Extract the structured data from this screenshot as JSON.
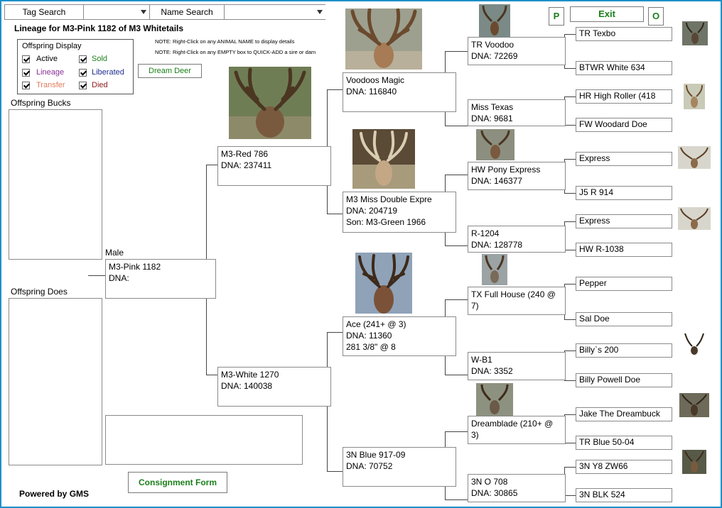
{
  "toolbar": {
    "tag_search_label": "Tag Search",
    "tag_search_value": "",
    "name_search_label": "Name Search",
    "name_search_value": "",
    "p_button": "P",
    "exit_button": "Exit",
    "o_button": "O"
  },
  "header": {
    "title": "Lineage for M3-Pink 1182 of M3 Whitetails",
    "note1": "NOTE: Right-Click on any ANIMAL NAME to display details",
    "note2": "NOTE: Right-Click on any EMPTY box to QUICK-ADD a sire or dam"
  },
  "offspring_display": {
    "title": "Offspring Display",
    "options": [
      {
        "label": "Active",
        "color": "#000000",
        "checked": true
      },
      {
        "label": "Sold",
        "color": "#1a7f1a",
        "checked": true
      },
      {
        "label": "Lineage",
        "color": "#8b2f9a",
        "checked": true
      },
      {
        "label": "Liberated",
        "color": "#1f2f8f",
        "checked": true
      },
      {
        "label": "Transfer",
        "color": "#e07a5a",
        "checked": true
      },
      {
        "label": "Died",
        "color": "#8b1a1a",
        "checked": true
      }
    ]
  },
  "dream_deer_button": "Dream Deer",
  "offspring_bucks_label": "Offspring Bucks",
  "offspring_does_label": "Offspring Does",
  "consignment_button": "Consignment Form",
  "powered_by": "Powered by GMS",
  "pedigree": {
    "subject": {
      "sex_label": "Male",
      "name": "M3-Pink 1182",
      "dna": "DNA:"
    },
    "sire": {
      "name": "M3-Red 786",
      "dna": "DNA: 237411"
    },
    "dam": {
      "name": "M3-White 1270",
      "dna": "DNA: 140038"
    },
    "ss": {
      "name": "Voodoos Magic",
      "dna": "DNA: 116840"
    },
    "sd": {
      "name": "M3 Miss Double Expre",
      "dna": "DNA: 204719",
      "extra": "Son: M3-Green 1966"
    },
    "ds": {
      "name": "Ace (241+ @ 3)",
      "dna": "DNA: 11360",
      "extra": "281 3/8\" @ 8"
    },
    "dd": {
      "name": "3N Blue 917-09",
      "dna": "DNA: 70752"
    },
    "sss": {
      "name": "TR Voodoo",
      "dna": "DNA: 72269"
    },
    "ssd": {
      "name": "Miss Texas",
      "dna": "DNA: 9681"
    },
    "sds": {
      "name": "HW Pony Express",
      "dna": "DNA: 146377"
    },
    "sdd": {
      "name": "R-1204",
      "dna": "DNA: 128778"
    },
    "dss": {
      "name": "TX Full House (240 @",
      "name2": "7)"
    },
    "dsd": {
      "name": "W-B1",
      "dna": "DNA: 3352"
    },
    "dds": {
      "name": "Dreamblade (210+ @",
      "name2": "3)"
    },
    "ddd": {
      "name": "3N O 708",
      "dna": "DNA: 30865"
    },
    "g4": [
      "TR Texbo",
      "BTWR White 634",
      "HR High Roller (418",
      "FW Woodard Doe",
      "Express",
      "J5 R 914",
      "Express",
      "HW R-1038",
      "Pepper",
      "Sal Doe",
      "Billy`s 200",
      "Billy Powell Doe",
      "Jake The Dreambuck",
      "TR Blue 50-04",
      "3N Y8 ZW66",
      "3N BLK 524"
    ]
  }
}
